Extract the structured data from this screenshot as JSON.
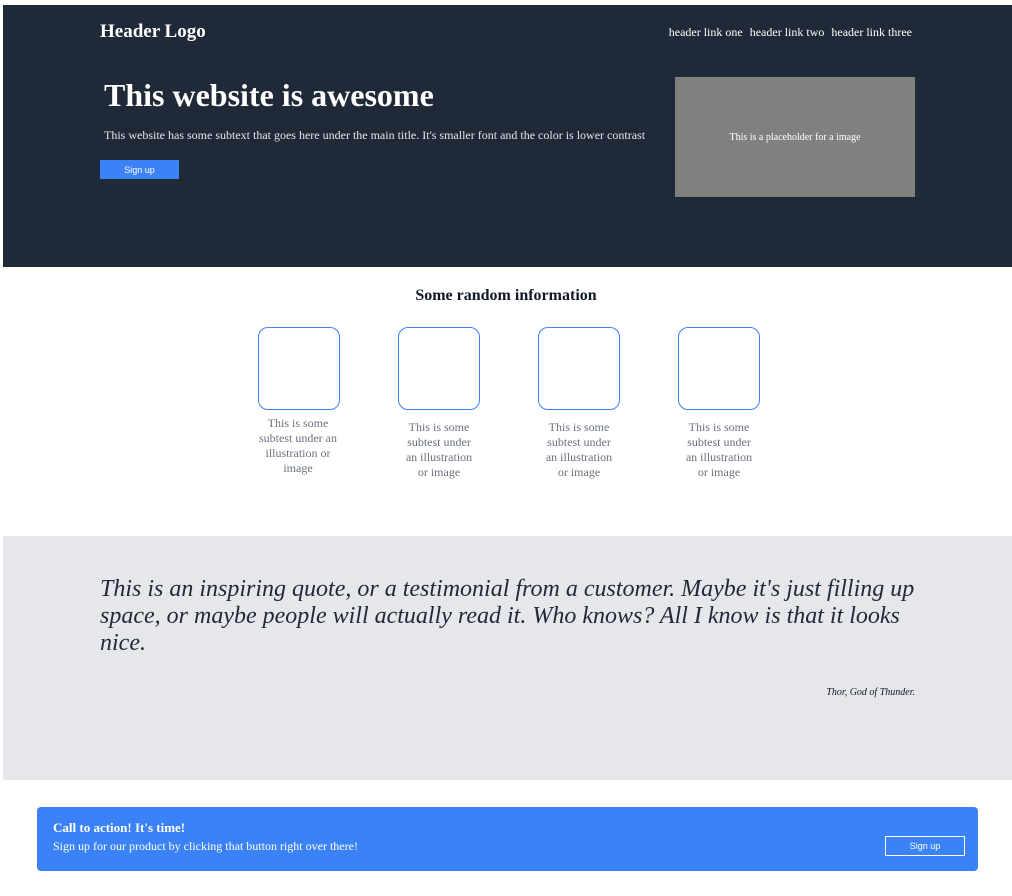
{
  "colors": {
    "hero_bg": "#1f2937",
    "accent": "#3b82f6",
    "image_placeholder": "#808080",
    "quote_bg": "#e5e7eb",
    "caption_text": "#6b7280"
  },
  "header": {
    "logo": "Header Logo",
    "nav": [
      "header link one",
      "header link two",
      "header link three"
    ]
  },
  "hero": {
    "title": "This website is awesome",
    "subtitle": "This website has some subtext that goes here under the main title. It's smaller font and the color is lower contrast",
    "button_label": "Sign up",
    "image_placeholder": "This is a placeholder for a image"
  },
  "info": {
    "title": "Some random information",
    "cards": [
      {
        "caption": "This is some subtest under an illustration or image"
      },
      {
        "caption": "This is some subtest under an illustration or image"
      },
      {
        "caption": "This is some subtest under an illustration or image"
      },
      {
        "caption": "This is some subtest under an illustration or image"
      }
    ]
  },
  "quote": {
    "text": "This is an inspiring quote, or a testimonial from a customer. Maybe it's just filling up space, or maybe people will actually read it. Who knows? All I know is that it looks nice.",
    "author": "Thor, God of Thunder."
  },
  "cta": {
    "title": "Call to action! It's time!",
    "subtitle": "Sign up for our product by clicking that button right over there!",
    "button_label": "Sign up"
  }
}
